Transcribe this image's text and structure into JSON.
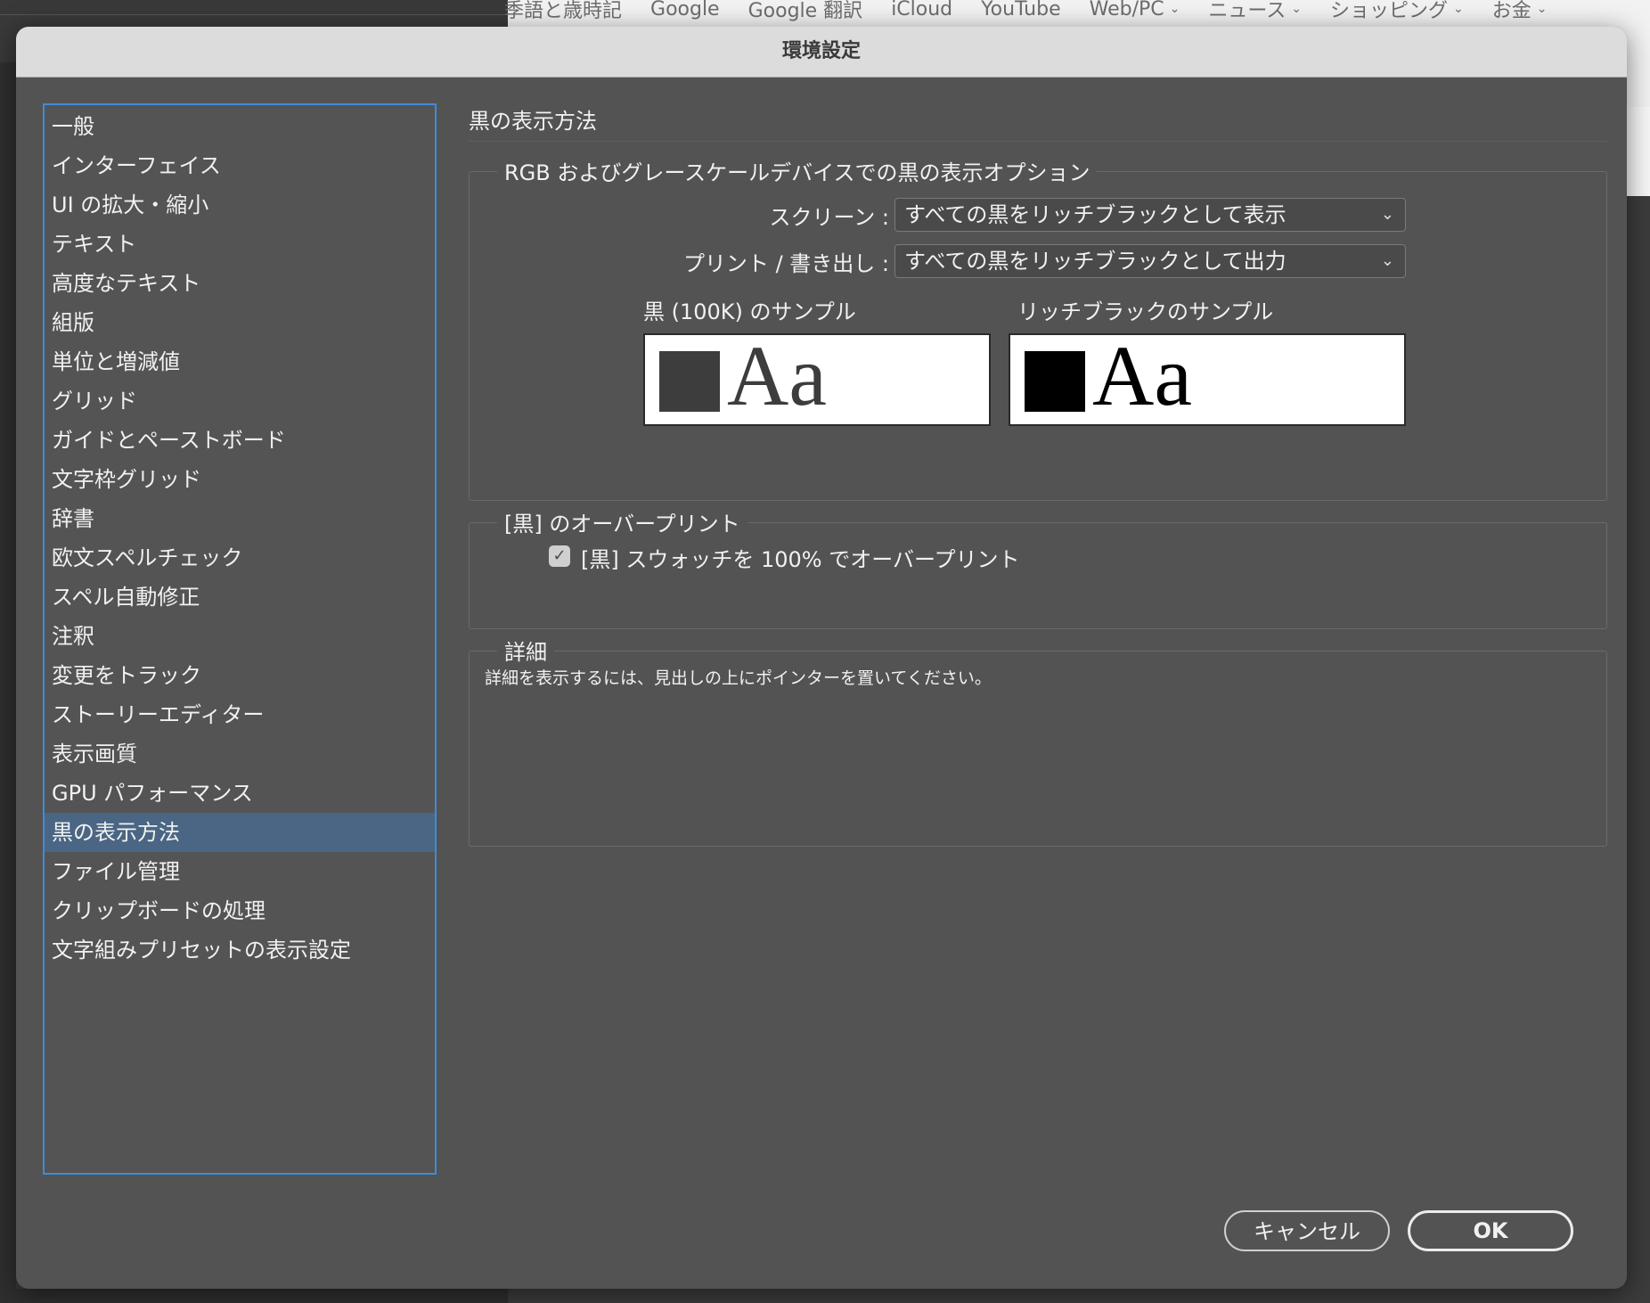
{
  "browser": {
    "bookmarks": [
      {
        "label": "季語と歳時記",
        "dropdown": false
      },
      {
        "label": "Google",
        "dropdown": false
      },
      {
        "label": "Google 翻訳",
        "dropdown": false
      },
      {
        "label": "iCloud",
        "dropdown": false
      },
      {
        "label": "YouTube",
        "dropdown": false
      },
      {
        "label": "Web/PC",
        "dropdown": true
      },
      {
        "label": "ニュース",
        "dropdown": true
      },
      {
        "label": "ショッピング",
        "dropdown": true
      },
      {
        "label": "お金",
        "dropdown": true
      }
    ]
  },
  "dialog": {
    "title": "環境設定",
    "categories": [
      "一般",
      "インターフェイス",
      "UI の拡大・縮小",
      "テキスト",
      "高度なテキスト",
      "組版",
      "単位と増減値",
      "グリッド",
      "ガイドとペーストボード",
      "文字枠グリッド",
      "辞書",
      "欧文スペルチェック",
      "スペル自動修正",
      "注釈",
      "変更をトラック",
      "ストーリーエディター",
      "表示画質",
      "GPU パフォーマンス",
      "黒の表示方法",
      "ファイル管理",
      "クリップボードの処理",
      "文字組みプリセットの表示設定"
    ],
    "selected_category": "黒の表示方法",
    "pane_title": "黒の表示方法",
    "rgb_group": {
      "legend": "RGB およびグレースケールデバイスでの黒の表示オプション",
      "screen_label": "スクリーン :",
      "screen_value": "すべての黒をリッチブラックとして表示",
      "print_label": "プリント / 書き出し :",
      "print_value": "すべての黒をリッチブラックとして出力",
      "sample_100k_label": "黒 (100K) のサンプル",
      "sample_rich_label": "リッチブラックのサンプル",
      "sample_text": "Aa"
    },
    "overprint_group": {
      "legend": "[黒] のオーバープリント",
      "checkbox_label": "[黒] スウォッチを 100% でオーバープリント",
      "checked": true
    },
    "details_group": {
      "legend": "詳細",
      "text": "詳細を表示するには、見出しの上にポインターを置いてください。"
    },
    "buttons": {
      "cancel": "キャンセル",
      "ok": "OK"
    }
  },
  "colors": {
    "selection": "#4a6684",
    "list_focus_border": "#3f8cd8",
    "black_100k": "#3d3d3d",
    "rich_black": "#000000"
  }
}
